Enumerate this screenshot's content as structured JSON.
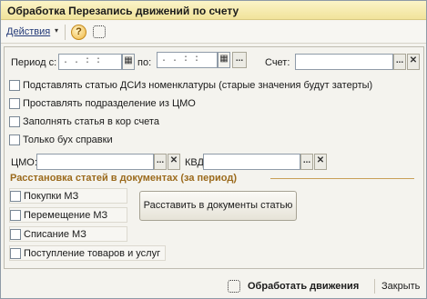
{
  "window": {
    "title": "Обработка  Перезапись движений по счету"
  },
  "toolbar": {
    "actions_label": "Действия",
    "actions_arrow": "▾",
    "help_label": "?"
  },
  "filters": {
    "period_from_label": "Период с:",
    "period_from_value": " .  .     :  :",
    "period_to_label": "по:",
    "period_to_value": " .  .     :  :",
    "account_label": "Счет:",
    "account_value": "",
    "calendar_icon": "▦",
    "select_button": "...",
    "clear_button": "✕"
  },
  "options": {
    "items": [
      "Подставлять статью ДСИз номенклатуры (старые значения будут затерты)",
      "Проставлять подразделение из ЦМО",
      "Заполнять статья в кор счета",
      "Только бух справки"
    ]
  },
  "cmo": {
    "cmo_label": "ЦМО:",
    "cmo_value": "",
    "kvd_label": "КВД:",
    "kvd_value": ""
  },
  "distribution": {
    "section_title": "Расстановка статей в документах (за период)",
    "documents": [
      "Покупки МЗ",
      "Перемещение МЗ",
      "Списание МЗ",
      "Поступление товаров и услуг"
    ],
    "apply_button": "Расставить в документы статью"
  },
  "bottom": {
    "process_label": "Обработать движения",
    "close_label": "Закрыть"
  }
}
